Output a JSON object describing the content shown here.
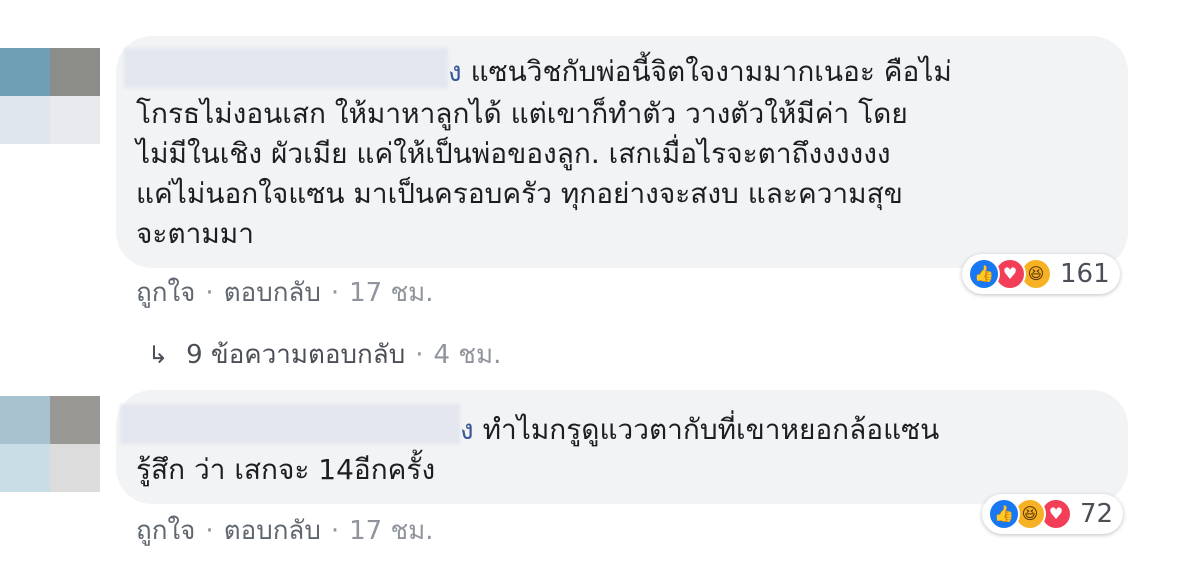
{
  "comments": [
    {
      "author_tail": "ง",
      "lines": [
        "แซนวิชกับพ่อนี้จิตใจงามมากเนอะ คือไม่",
        "โกรธไม่งอนเสก ให้มาหาลูกได้ แต่เขาก็ทำตัว วางตัวให้มีค่า โดย",
        "ไม่มีในเชิง ผัวเมีย แค่ให้เป็นพ่อของลูก. เสกเมื่อไรจะตาถึงงงงงง",
        "แค่ไม่นอกใจแซน มาเป็นครอบครัว ทุกอย่างจะสงบ และความสุข",
        "จะตามมา"
      ],
      "like_label": "ถูกใจ",
      "reply_label": "ตอบกลับ",
      "time": "17 ชม.",
      "reaction_count": "161",
      "reactions": [
        "like-icon",
        "love-icon",
        "haha-icon"
      ]
    },
    {
      "author_tail": "ง",
      "lines": [
        "ทำไมกรูดูแววตากับที่เขาหยอกล้อแซน",
        "รู้สึก ว่า เสกจะ 14อีกครั้ง"
      ],
      "like_label": "ถูกใจ",
      "reply_label": "ตอบกลับ",
      "time": "17 ชม.",
      "reaction_count": "72",
      "reactions": [
        "like-icon",
        "haha-icon",
        "love-icon"
      ]
    }
  ],
  "reply_thread": {
    "label": "9 ข้อความตอบกลับ",
    "time": "4 ชม."
  },
  "separator": "·",
  "colors": {
    "bubble": "#f2f3f5",
    "author": "#385898",
    "meta": "#90949c",
    "like": "#1877f2",
    "love": "#f33e58",
    "haha": "#f7b125"
  }
}
